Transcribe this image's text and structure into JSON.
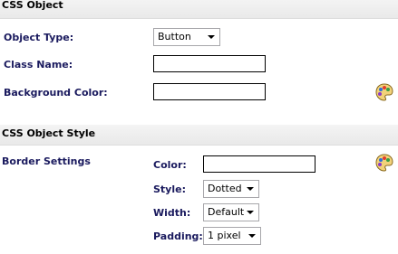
{
  "css_object": {
    "header": "CSS Object",
    "object_type_label": "Object Type:",
    "object_type_value": "Button",
    "class_name_label": "Class Name:",
    "class_name_value": "",
    "background_color_label": "Background Color:",
    "background_color_value": ""
  },
  "css_object_style": {
    "header": "CSS Object Style",
    "border_settings_label": "Border Settings",
    "color_label": "Color:",
    "color_value": "",
    "style_label": "Style:",
    "style_value": "Dotted",
    "width_label": "Width:",
    "width_value": "Default",
    "padding_label": "Padding:",
    "padding_value": "1 pixel"
  },
  "icons": [
    "color-palette-icon"
  ]
}
